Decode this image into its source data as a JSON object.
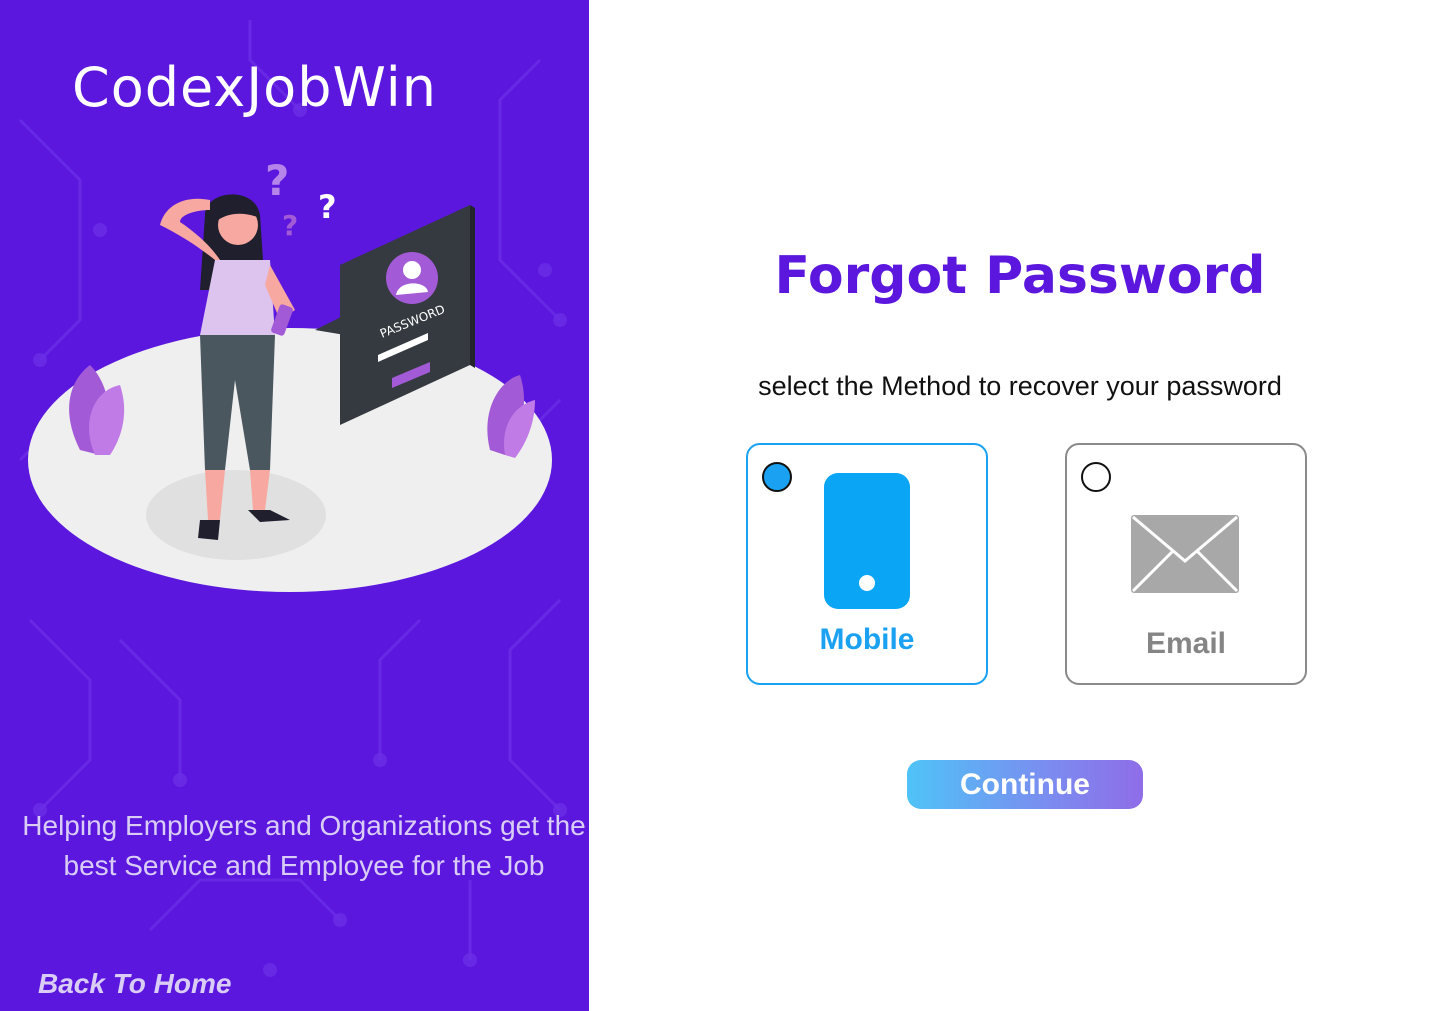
{
  "brand": {
    "name": "CodexJobWin"
  },
  "illustration": {
    "screen_text": "PASSWORD"
  },
  "left": {
    "tagline": "Helping Employers and Organizations get the best Service and Employee for the Job",
    "back_link": "Back To Home"
  },
  "main": {
    "title": "Forgot Password",
    "subtitle": "select the Method to recover your password",
    "options": [
      {
        "label": "Mobile",
        "icon": "mobile-phone-icon",
        "selected": true
      },
      {
        "label": "Email",
        "icon": "envelope-icon",
        "selected": false
      }
    ],
    "continue_label": "Continue"
  },
  "colors": {
    "brand_purple": "#5b17dd",
    "accent_blue": "#1aa1f1",
    "neutral_gray": "#8a8a8a"
  }
}
